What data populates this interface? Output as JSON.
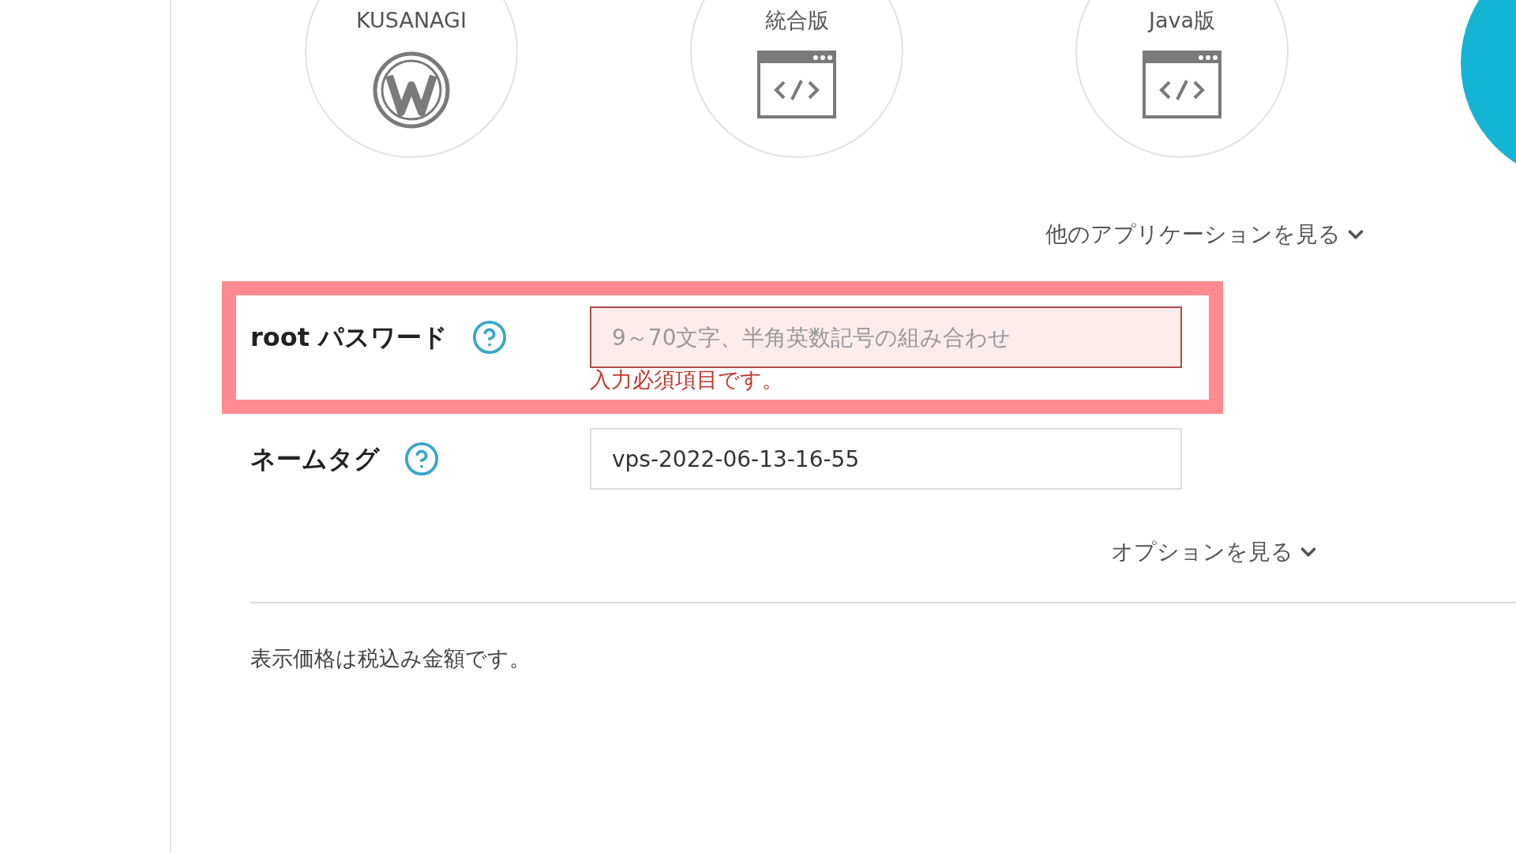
{
  "apps": [
    {
      "label": "KUSANAGI",
      "kind": "wordpress"
    },
    {
      "label": "統合版",
      "kind": "code-window"
    },
    {
      "label": "Java版",
      "kind": "code-window"
    }
  ],
  "more_apps_link": "他のアプリケーションを見る",
  "fields": [
    {
      "label": "root パスワード",
      "placeholder": "9～70文字、半角英数記号の組み合わせ",
      "error": "入力必須項目です。",
      "invalid": true,
      "highlighted": true
    },
    {
      "label": "ネームタグ",
      "value": "vps-2022-06-13-16-55",
      "invalid": false,
      "highlighted": false
    }
  ],
  "options_link": "オプションを見る",
  "tax_note": "表示価格は税込み金額です。"
}
